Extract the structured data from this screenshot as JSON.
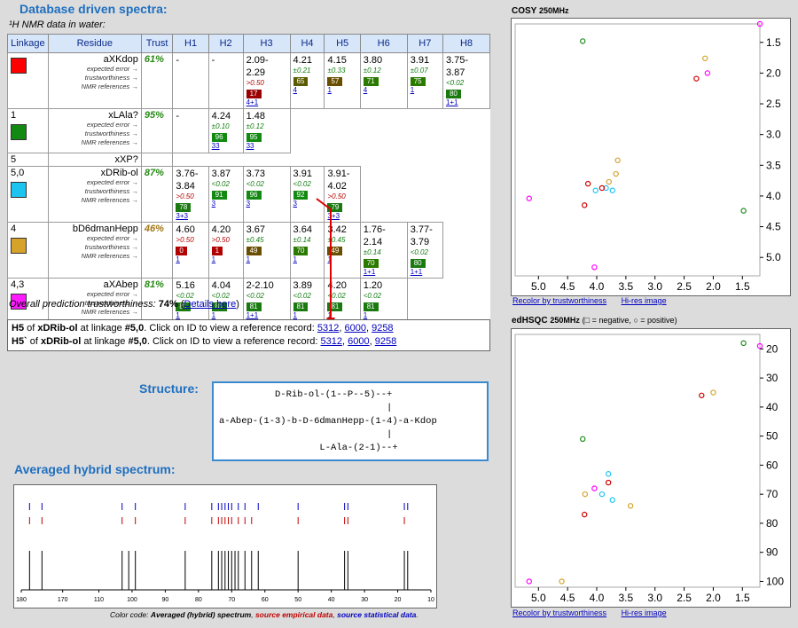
{
  "page": {
    "title": "Database driven spectra:",
    "nmr_caption": "¹H NMR data in water:",
    "overall_prefix": "Overall prediction trustworthiness: ",
    "overall_value": "74%",
    "details_link": "Details here",
    "structure_title": "Structure:",
    "hybrid_title": "Averaged hybrid spectrum:",
    "color_code_prefix": "Color code: ",
    "color_code_avg": "Averaged (hybrid) spectrum",
    "color_code_emp": "source empirical data",
    "color_code_stat": "source statistical data"
  },
  "table": {
    "headers": [
      "Linkage",
      "Residue",
      "Trust",
      "H1",
      "H2",
      "H3",
      "H4",
      "H5",
      "H6",
      "H7",
      "H8"
    ],
    "row_labels": [
      "expected error →",
      "trustworthiness →",
      "NMR references →"
    ],
    "rows": [
      {
        "linkage": "",
        "residue": "aXKdop",
        "trust": "61%",
        "swatch": "#ff0000",
        "h": [
          {
            "v": "-"
          },
          {
            "v": "-"
          },
          {
            "v": "2.09-2.29",
            "e": ">0.50",
            "ec": "red",
            "b": "17",
            "bc": "#9a0000",
            "r": "4+1"
          },
          {
            "v": "4.21",
            "e": "±0.21",
            "ec": "grn",
            "b": "65",
            "bc": "#5a5a00",
            "r": "4"
          },
          {
            "v": "4.15",
            "e": "±0.33",
            "ec": "grn",
            "b": "57",
            "bc": "#6a4e00",
            "r": "1"
          },
          {
            "v": "3.80",
            "e": "±0.12",
            "ec": "grn",
            "b": "71",
            "bc": "#2a7a00",
            "r": "4"
          },
          {
            "v": "3.91",
            "e": "±0.07",
            "ec": "grn",
            "b": "75",
            "bc": "#2a7a00",
            "r": "1"
          },
          {
            "v": "3.75-3.87",
            "e": "<0.02",
            "ec": "grn",
            "b": "80",
            "bc": "#1a7a10",
            "r": "1+1"
          }
        ]
      },
      {
        "linkage": "1",
        "residue": "xLAla?",
        "trust": "95%",
        "swatch": "#128a12",
        "h": [
          {
            "v": "-"
          },
          {
            "v": "4.24",
            "e": "±0.10",
            "ec": "grn",
            "b": "96",
            "bc": "#128a12",
            "r": "33"
          },
          {
            "v": "1.48",
            "e": "±0.12",
            "ec": "grn",
            "b": "95",
            "bc": "#128a12",
            "r": "33"
          }
        ]
      },
      {
        "linkage": "5",
        "residue": "xXP?",
        "trust": "",
        "swatch": "",
        "h": []
      },
      {
        "linkage": "5,0",
        "residue": "xDRib-ol",
        "trust": "87%",
        "swatch": "#1ec4f0",
        "h": [
          {
            "v": "3.76-3.84",
            "e": ">0.50",
            "ec": "red",
            "b": "78",
            "bc": "#1a7a10",
            "r": "3+3"
          },
          {
            "v": "3.87",
            "e": "<0.02",
            "ec": "grn",
            "b": "91",
            "bc": "#128a12",
            "r": "3"
          },
          {
            "v": "3.73",
            "e": "<0.02",
            "ec": "grn",
            "b": "96",
            "bc": "#128a12",
            "r": "3"
          },
          {
            "v": "3.91",
            "e": "<0.02",
            "ec": "grn",
            "b": "92",
            "bc": "#128a12",
            "r": "3"
          },
          {
            "v": "3.91-4.02",
            "e": ">0.50",
            "ec": "red",
            "b": "79",
            "bc": "#1a7a10",
            "r": "3+3"
          }
        ]
      },
      {
        "linkage": "4",
        "residue": "bD6dmanHepp",
        "trust": "46%",
        "swatch": "#d6a22a",
        "h": [
          {
            "v": "4.60",
            "e": ">0.50",
            "ec": "red",
            "b": "0",
            "bc": "#b00000",
            "r": "1"
          },
          {
            "v": "4.20",
            "e": ">0.50",
            "ec": "red",
            "b": "1",
            "bc": "#b00000",
            "r": "1"
          },
          {
            "v": "3.67",
            "e": "±0.45",
            "ec": "grn",
            "b": "49",
            "bc": "#6a4e00",
            "r": "1"
          },
          {
            "v": "3.64",
            "e": "±0.14",
            "ec": "grn",
            "b": "70",
            "bc": "#2a7a00",
            "r": "1"
          },
          {
            "v": "3.42",
            "e": "±0.45",
            "ec": "grn",
            "b": "49",
            "bc": "#6a4e00",
            "r": "1"
          },
          {
            "v": "1.76-2.14",
            "e": "±0.14",
            "ec": "grn",
            "b": "70",
            "bc": "#2a7a00",
            "r": "1+1"
          },
          {
            "v": "3.77-3.79",
            "e": "<0.02",
            "ec": "grn",
            "b": "80",
            "bc": "#1a7a10",
            "r": "1+1"
          }
        ]
      },
      {
        "linkage": "4,3",
        "residue": "aXAbep",
        "trust": "81%",
        "swatch": "#ff1aff",
        "h": [
          {
            "v": "5.16",
            "e": "<0.02",
            "ec": "grn",
            "b": "81",
            "bc": "#1a7a10",
            "r": "1"
          },
          {
            "v": "4.04",
            "e": "<0.02",
            "ec": "grn",
            "b": "81",
            "bc": "#1a7a10",
            "r": "1"
          },
          {
            "v": "2-2.10",
            "e": "<0.02",
            "ec": "grn",
            "b": "81",
            "bc": "#1a7a10",
            "r": "1+1"
          },
          {
            "v": "3.89",
            "e": "<0.02",
            "ec": "grn",
            "b": "81",
            "bc": "#1a7a10",
            "r": "1"
          },
          {
            "v": "4.20",
            "e": "<0.02",
            "ec": "grn",
            "b": "81",
            "bc": "#1a7a10",
            "r": "1"
          },
          {
            "v": "1.20",
            "e": "<0.02",
            "ec": "grn",
            "b": "81",
            "bc": "#1a7a10",
            "r": "1"
          }
        ]
      }
    ]
  },
  "info": {
    "line1_a": "H5",
    "line1_b": " of ",
    "line1_c": "xDRib-ol",
    "line1_d": " at linkage ",
    "line1_e": "#5,0",
    "line1_f": ".  Click on ID to view a reference record: ",
    "line2_a": "H5`",
    "line2_b": " of ",
    "line2_c": "xDRib-ol",
    "line2_d": " at linkage ",
    "line2_e": "#5,0",
    "line2_f": ".  Click on ID to view a reference record: ",
    "refs": [
      "5312",
      "6000",
      "9258"
    ]
  },
  "structure": {
    "line1": "          D-Rib-ol-(1--P--5)--+",
    "line2": "                              |",
    "line3": "a-Abep-(1-3)-b-D-6dmanHepp-(1-4)-a-Kdop",
    "line4": "                              |",
    "line5": "                  L-Ala-(2-1)--+"
  },
  "cosy": {
    "title": "COSY",
    "freq": "250MHz",
    "x_ticks": [
      "5.0",
      "4.5",
      "4.0",
      "3.5",
      "3.0",
      "2.5",
      "2.0",
      "1.5"
    ],
    "y_ticks": [
      "1.5",
      "2.0",
      "2.5",
      "3.0",
      "3.5",
      "4.0",
      "4.5",
      "5.0"
    ],
    "recolor": "Recolor by trustworthiness",
    "hires": "Hi-res image"
  },
  "hsqc": {
    "title": "edHSQC",
    "freq": "250MHz",
    "legend": "(□ = negative, ○ = positive)",
    "x_ticks": [
      "5.0",
      "4.5",
      "4.0",
      "3.5",
      "3.0",
      "2.5",
      "2.0",
      "1.5"
    ],
    "y_ticks": [
      "20",
      "30",
      "40",
      "50",
      "60",
      "70",
      "80",
      "90",
      "100"
    ],
    "recolor": "Recolor by trustworthiness",
    "hires": "Hi-res image"
  },
  "spectrum": {
    "x_ticks": [
      "180",
      "170",
      "110",
      "100",
      "90",
      "80",
      "70",
      "60",
      "50",
      "40",
      "30",
      "20",
      "10"
    ]
  },
  "chart_data": [
    {
      "type": "scatter",
      "title": "COSY",
      "xlim": [
        5.4,
        1.2
      ],
      "ylim": [
        1.2,
        5.3
      ],
      "series": [
        {
          "color": "#ff00ff",
          "values": [
            [
              5.16,
              4.04
            ],
            [
              4.04,
              5.16
            ],
            [
              1.2,
              1.2
            ],
            [
              2.1,
              2.0
            ]
          ]
        },
        {
          "color": "#d6a22a",
          "values": [
            [
              3.67,
              3.64
            ],
            [
              2.14,
              1.76
            ],
            [
              3.79,
              3.77
            ],
            [
              3.64,
              3.42
            ]
          ]
        },
        {
          "color": "#1ec4f0",
          "values": [
            [
              3.84,
              3.87
            ],
            [
              3.73,
              3.91
            ],
            [
              4.02,
              3.91
            ]
          ]
        },
        {
          "color": "#d00000",
          "values": [
            [
              4.21,
              4.15
            ],
            [
              4.15,
              3.8
            ],
            [
              3.91,
              3.87
            ],
            [
              2.29,
              2.09
            ]
          ]
        },
        {
          "color": "#1a8a1a",
          "values": [
            [
              4.24,
              1.48
            ],
            [
              1.48,
              4.24
            ]
          ]
        }
      ]
    },
    {
      "type": "scatter",
      "title": "edHSQC",
      "xlim": [
        5.4,
        1.2
      ],
      "ylim": [
        15,
        102
      ],
      "series": [
        {
          "color": "#ff00ff",
          "values": [
            [
              5.16,
              100
            ],
            [
              4.04,
              68
            ],
            [
              1.2,
              19
            ]
          ]
        },
        {
          "color": "#d6a22a",
          "values": [
            [
              4.6,
              100
            ],
            [
              4.2,
              70
            ],
            [
              3.42,
              74
            ],
            [
              2.0,
              35
            ]
          ]
        },
        {
          "color": "#1ec4f0",
          "values": [
            [
              3.8,
              63
            ],
            [
              3.91,
              70
            ],
            [
              3.73,
              72
            ]
          ]
        },
        {
          "color": "#d00000",
          "values": [
            [
              4.21,
              77
            ],
            [
              3.8,
              66
            ],
            [
              2.2,
              36
            ]
          ]
        },
        {
          "color": "#1a8a1a",
          "values": [
            [
              4.24,
              51
            ],
            [
              1.48,
              18
            ]
          ]
        }
      ]
    },
    {
      "type": "bar",
      "title": "",
      "xlim": [
        180,
        10
      ],
      "series": [
        {
          "name": "Averaged (hybrid) spectrum",
          "color": "#000000",
          "values": [
            [
              178,
              1
            ],
            [
              175,
              1
            ],
            [
              103,
              1
            ],
            [
              101,
              1
            ],
            [
              99,
              1
            ],
            [
              84,
              1
            ],
            [
              76,
              1
            ],
            [
              74,
              1
            ],
            [
              73,
              1
            ],
            [
              72,
              1
            ],
            [
              71,
              1
            ],
            [
              70,
              1
            ],
            [
              69,
              1
            ],
            [
              68,
              1
            ],
            [
              66,
              1
            ],
            [
              64,
              1
            ],
            [
              62,
              1
            ],
            [
              50,
              1
            ],
            [
              36,
              1
            ],
            [
              35,
              1
            ],
            [
              18,
              1
            ],
            [
              17,
              1
            ]
          ]
        },
        {
          "name": "source empirical data",
          "color": "#c00000",
          "values": [
            [
              178,
              1
            ],
            [
              175,
              1
            ],
            [
              103,
              1
            ],
            [
              99,
              1
            ],
            [
              84,
              1
            ],
            [
              76,
              1
            ],
            [
              74,
              1
            ],
            [
              73,
              1
            ],
            [
              72,
              1
            ],
            [
              71,
              1
            ],
            [
              70,
              1
            ],
            [
              68,
              1
            ],
            [
              66,
              1
            ],
            [
              64,
              1
            ],
            [
              50,
              1
            ],
            [
              36,
              1
            ],
            [
              35,
              1
            ],
            [
              18,
              1
            ]
          ]
        },
        {
          "name": "source statistical data",
          "color": "#0000c0",
          "values": [
            [
              178,
              1
            ],
            [
              175,
              1
            ],
            [
              103,
              1
            ],
            [
              99,
              1
            ],
            [
              84,
              1
            ],
            [
              76,
              1
            ],
            [
              74,
              1
            ],
            [
              73,
              1
            ],
            [
              72,
              1
            ],
            [
              71,
              1
            ],
            [
              70,
              1
            ],
            [
              68,
              1
            ],
            [
              66,
              1
            ],
            [
              62,
              1
            ],
            [
              50,
              1
            ],
            [
              36,
              1
            ],
            [
              35,
              1
            ],
            [
              18,
              1
            ],
            [
              17,
              1
            ]
          ]
        }
      ]
    }
  ]
}
